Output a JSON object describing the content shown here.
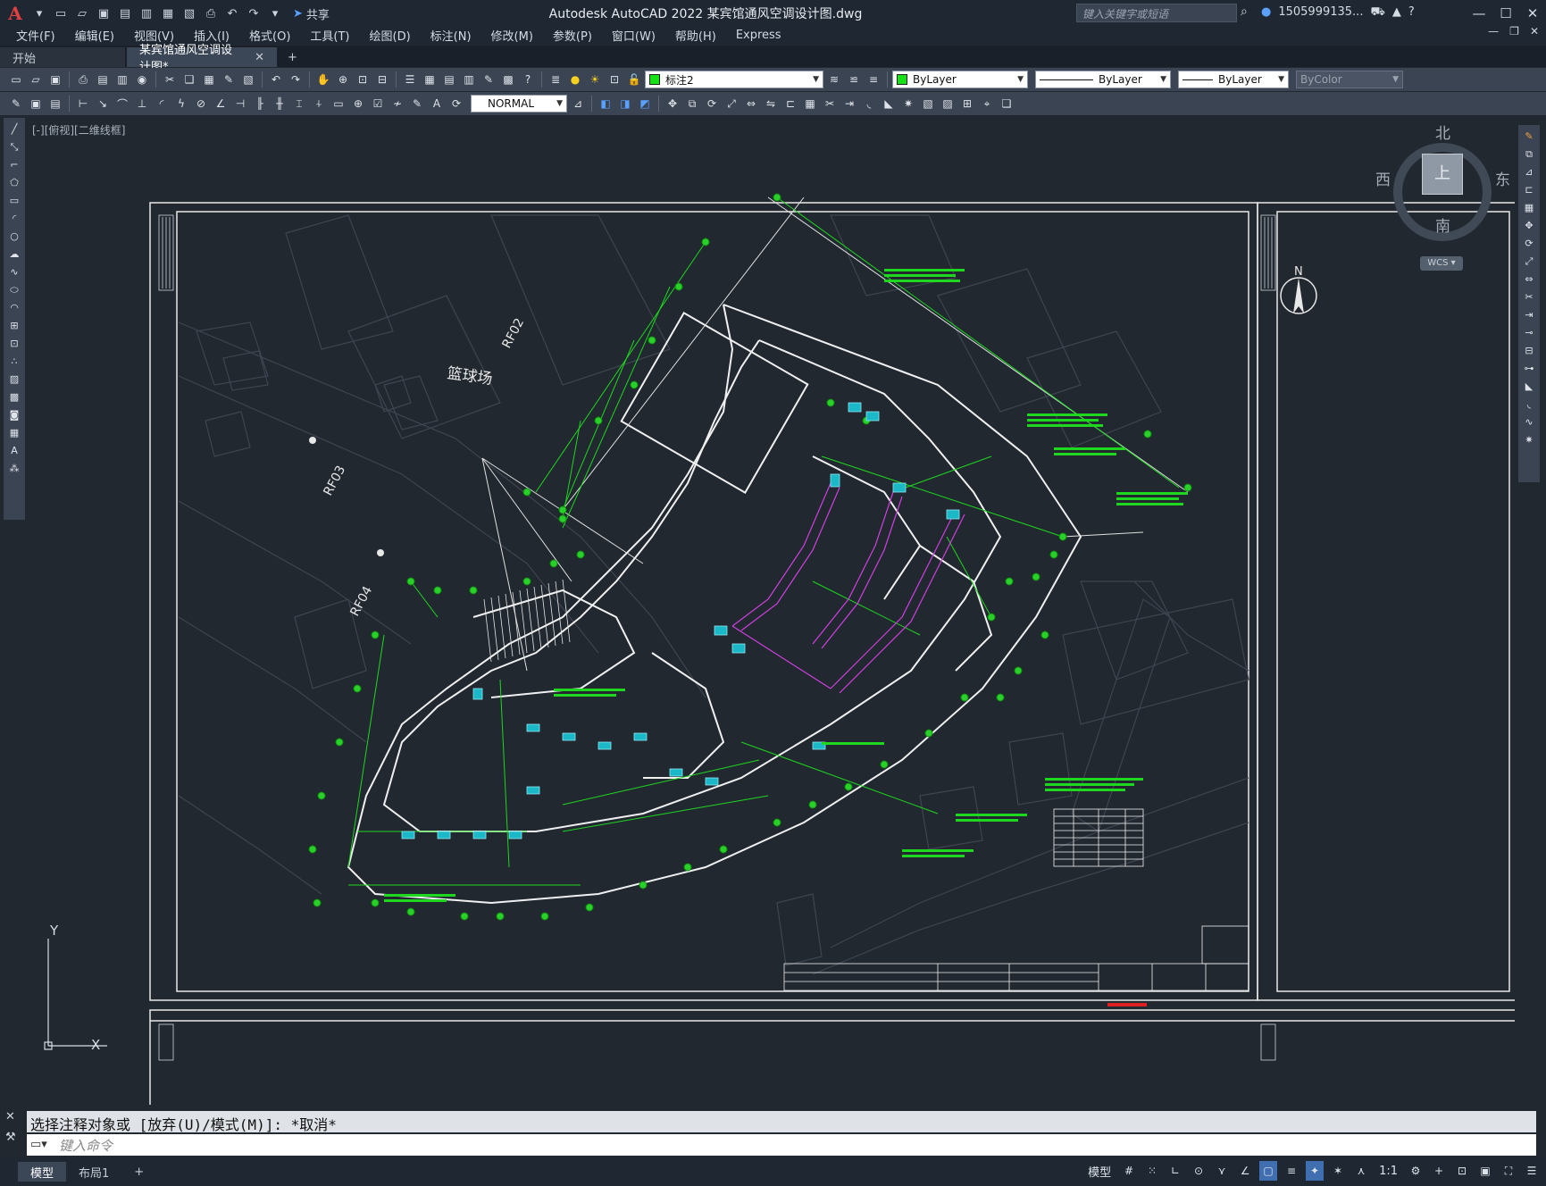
{
  "app": {
    "logo": "A",
    "window_title": "Autodesk AutoCAD 2022    某宾馆通风空调设计图.dwg",
    "share_label": "共享",
    "search_placeholder": "键入关键字或短语",
    "user_name": "1505999135...",
    "colors": {
      "accent": "#3f6fb0",
      "title_bg": "#1f2733",
      "toolbar_bg": "#3b4453",
      "canvas_bg": "#212830"
    }
  },
  "menu": {
    "items": [
      "文件(F)",
      "编辑(E)",
      "视图(V)",
      "插入(I)",
      "格式(O)",
      "工具(T)",
      "绘图(D)",
      "标注(N)",
      "修改(M)",
      "参数(P)",
      "窗口(W)",
      "帮助(H)",
      "Express"
    ]
  },
  "tabs": {
    "start": "开始",
    "active": "某宾馆通风空调设计图*",
    "close": "✕",
    "add": "+"
  },
  "properties": {
    "layer": "标注2",
    "color": "ByLayer",
    "linetype": "ByLayer",
    "lineweight": "ByLayer",
    "plotstyle": "ByColor",
    "dimstyle": "NORMAL"
  },
  "viewport": {
    "label": "[-][俯视][二维线框]",
    "viewcube": {
      "north": "北",
      "south": "南",
      "east": "东",
      "west": "西",
      "face": "上",
      "wcs": "WCS"
    },
    "drawing_labels": {
      "court": "篮球场",
      "rf02": "RF02",
      "rf03": "RF03",
      "rf04": "RF04",
      "north_arrow": "N"
    },
    "ucs_x": "X",
    "ucs_y": "Y"
  },
  "command": {
    "history": "选择注释对象或 [放弃(U)/模式(M)]: *取消*",
    "placeholder": "键入命令"
  },
  "status": {
    "layout_tabs": [
      "模型",
      "布局1"
    ],
    "add": "+",
    "model_label": "模型",
    "scale": "1:1"
  }
}
